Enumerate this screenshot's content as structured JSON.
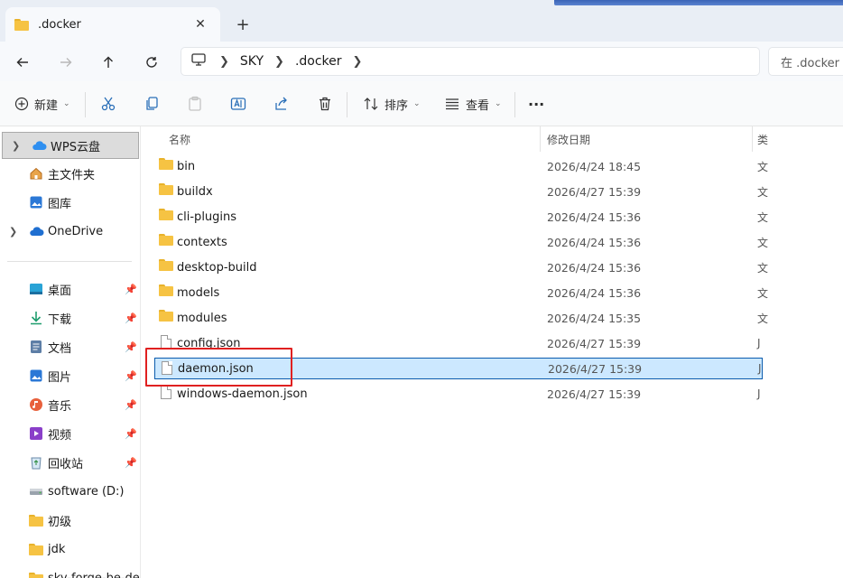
{
  "tab": {
    "title": ".docker",
    "close_glyph": "✕",
    "new_tab_glyph": "+"
  },
  "breadcrumb": {
    "items": [
      "SKY",
      ".docker"
    ]
  },
  "search": {
    "placeholder": "在 .docker 中搜索"
  },
  "toolbar": {
    "new_label": "新建",
    "sort_label": "排序",
    "view_label": "查看",
    "more_glyph": "···"
  },
  "sidebar": {
    "items": [
      {
        "label": "WPS云盘",
        "icon": "cloud-icon"
      },
      {
        "label": "主文件夹",
        "icon": "home-icon"
      },
      {
        "label": "图库",
        "icon": "gallery-icon"
      },
      {
        "label": "OneDrive",
        "icon": "cloud-icon"
      },
      {
        "label": "桌面",
        "icon": "desktop-icon"
      },
      {
        "label": "下载",
        "icon": "download-icon"
      },
      {
        "label": "文档",
        "icon": "document-icon"
      },
      {
        "label": "图片",
        "icon": "pictures-icon"
      },
      {
        "label": "音乐",
        "icon": "music-icon"
      },
      {
        "label": "视频",
        "icon": "video-icon"
      },
      {
        "label": "回收站",
        "icon": "recycle-bin-icon"
      },
      {
        "label": "software (D:)",
        "icon": "drive-icon"
      },
      {
        "label": "初级",
        "icon": "folder-icon"
      },
      {
        "label": "jdk",
        "icon": "folder-icon"
      },
      {
        "label": "sky-forge-be-der",
        "icon": "folder-icon"
      }
    ]
  },
  "columns": {
    "name": "名称",
    "modified": "修改日期",
    "type": "类"
  },
  "files": [
    {
      "name": "bin",
      "date": "2026/4/24 18:45",
      "kind": "folder",
      "type": "文"
    },
    {
      "name": "buildx",
      "date": "2026/4/27 15:39",
      "kind": "folder",
      "type": "文"
    },
    {
      "name": "cli-plugins",
      "date": "2026/4/24 15:36",
      "kind": "folder",
      "type": "文"
    },
    {
      "name": "contexts",
      "date": "2026/4/24 15:36",
      "kind": "folder",
      "type": "文"
    },
    {
      "name": "desktop-build",
      "date": "2026/4/24 15:36",
      "kind": "folder",
      "type": "文"
    },
    {
      "name": "models",
      "date": "2026/4/24 15:36",
      "kind": "folder",
      "type": "文"
    },
    {
      "name": "modules",
      "date": "2026/4/24 15:35",
      "kind": "folder",
      "type": "文"
    },
    {
      "name": "config.json",
      "date": "2026/4/27 15:39",
      "kind": "file",
      "type": "J"
    },
    {
      "name": "daemon.json",
      "date": "2026/4/27 15:39",
      "kind": "file",
      "type": "J",
      "selected": true
    },
    {
      "name": "windows-daemon.json",
      "date": "2026/4/27 15:39",
      "kind": "file",
      "type": "J"
    }
  ]
}
